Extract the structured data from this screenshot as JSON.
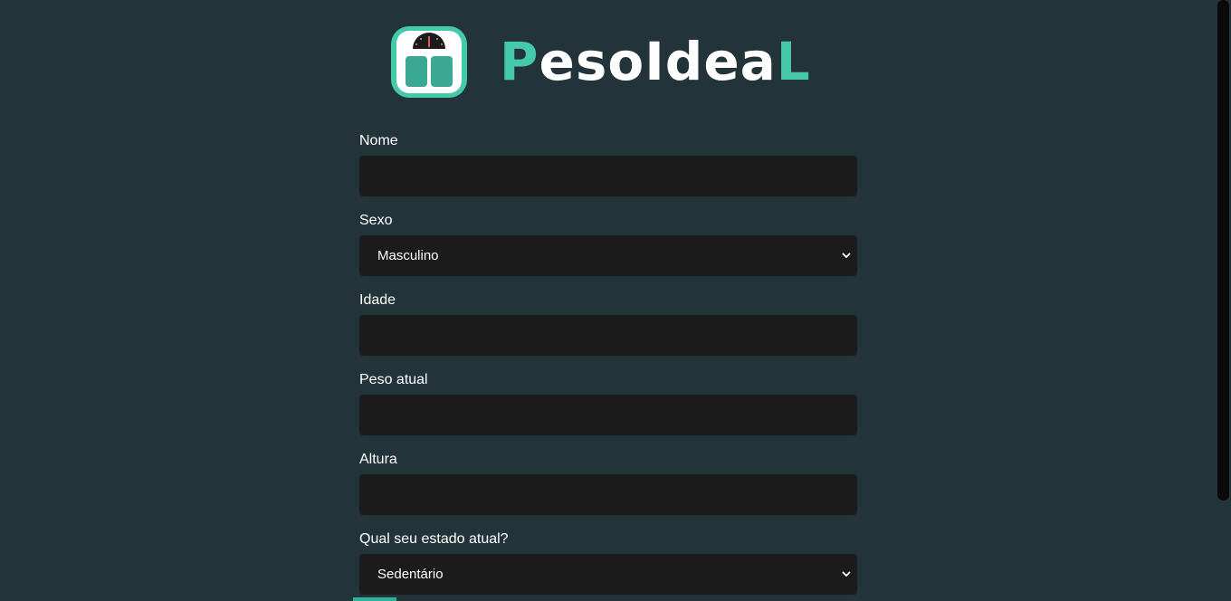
{
  "brand": {
    "name_part1": "P",
    "name_part2": "esoIdea",
    "name_part3": "L",
    "accent_color": "#44c9aa",
    "logo_icon": "scale-icon"
  },
  "form": {
    "fields": [
      {
        "label": "Nome",
        "type": "text",
        "value": ""
      },
      {
        "label": "Sexo",
        "type": "select",
        "value": "Masculino"
      },
      {
        "label": "Idade",
        "type": "text",
        "value": ""
      },
      {
        "label": "Peso atual",
        "type": "text",
        "value": ""
      },
      {
        "label": "Altura",
        "type": "text",
        "value": ""
      },
      {
        "label": "Qual seu estado atual?",
        "type": "select",
        "value": "Sedentário"
      }
    ]
  },
  "colors": {
    "background": "#23333a",
    "field_background": "#1b1b1b"
  }
}
